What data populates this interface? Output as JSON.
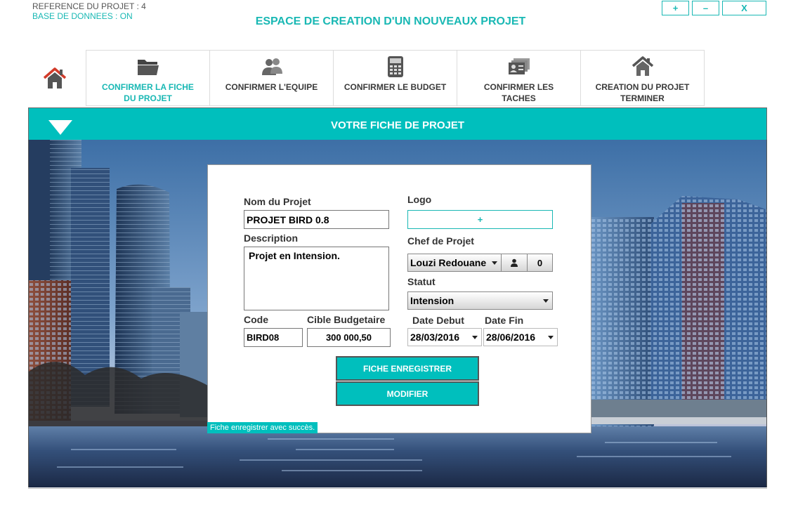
{
  "header": {
    "reference": "REFERENCE DU PROJET : 4",
    "database": "BASE DE DONNEES : ON",
    "title": "ESPACE DE CREATION D'UN NOUVEAUX PROJET"
  },
  "window": {
    "plus": "+",
    "minimize": "–",
    "close": "X"
  },
  "tabs": [
    {
      "label": "CONFIRMER LA FICHE DU PROJET",
      "icon": "folder-icon",
      "active": true
    },
    {
      "label": "CONFIRMER L'EQUIPE",
      "icon": "team-icon",
      "active": false
    },
    {
      "label": "CONFIRMER LE BUDGET",
      "icon": "calculator-icon",
      "active": false
    },
    {
      "label": "CONFIRMER LES TACHES",
      "icon": "id-cards-icon",
      "active": false
    },
    {
      "label": "CREATION DU PROJET TERMINER",
      "icon": "home-icon",
      "active": false
    }
  ],
  "panel": {
    "title": "VOTRE FICHE DE PROJET"
  },
  "form": {
    "name_label": "Nom du Projet",
    "name_value": "PROJET BIRD 0.8",
    "description_label": "Description",
    "description_value": "Projet en Intension.",
    "code_label": "Code",
    "code_value": "BIRD08",
    "budget_label": "Cible Budgetaire",
    "budget_value": "300 000,50",
    "logo_label": "Logo",
    "logo_button": "+",
    "chef_label": "Chef de Projet",
    "chef_value": "Louzi Redouane",
    "chef_count": "0",
    "statut_label": "Statut",
    "statut_value": "Intension",
    "date_debut_label": "Date Debut",
    "date_debut_value": "28/03/2016",
    "date_fin_label": "Date Fin",
    "date_fin_value": "28/06/2016",
    "save_button": "FICHE ENREGISTRER",
    "modify_button": "MODIFIER"
  },
  "status_message": "Fiche enregistrer avec succès.",
  "colors": {
    "accent": "#00bfbd",
    "accent_text": "#19b8b4"
  }
}
